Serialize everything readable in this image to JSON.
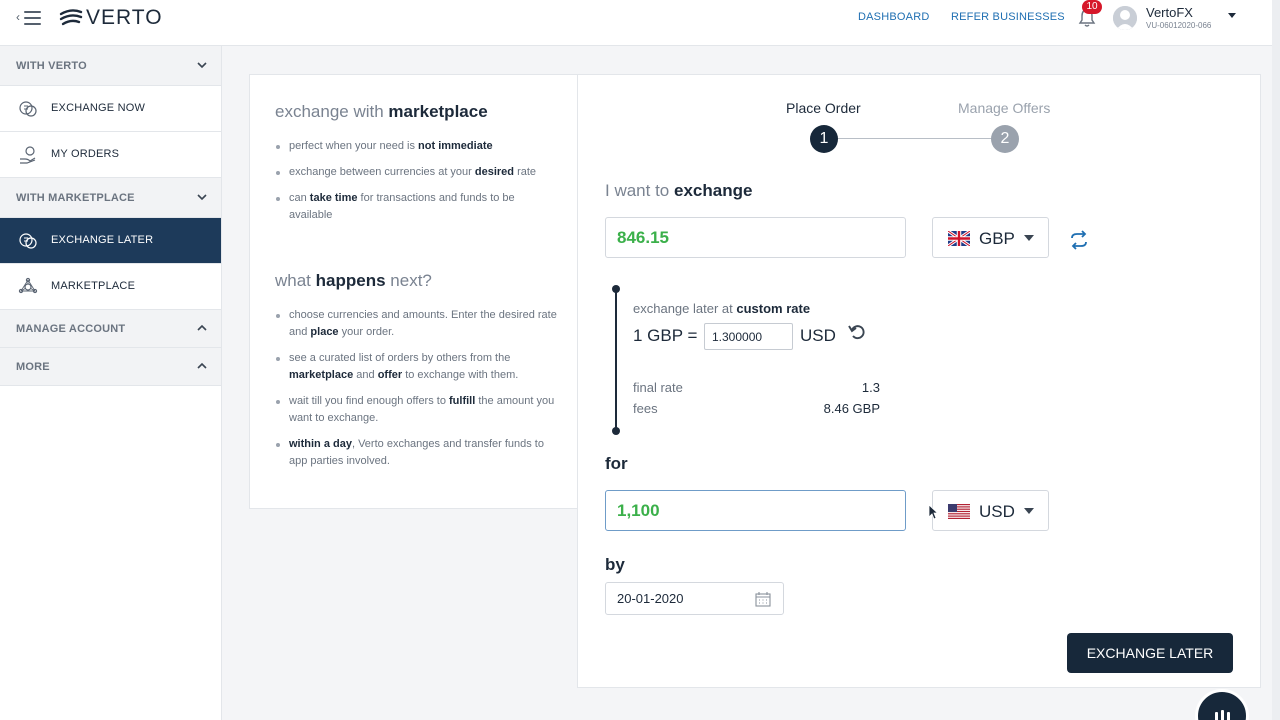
{
  "header": {
    "logo_text": "VERTO",
    "nav_dashboard": "DASHBOARD",
    "nav_refer": "REFER BUSINESSES",
    "notification_count": "10",
    "user_name": "VertoFX",
    "user_id": "VU-06012020-066"
  },
  "sidebar": {
    "section_with_verto": "WITH VERTO",
    "item_exchange_now": "EXCHANGE NOW",
    "item_my_orders": "MY ORDERS",
    "section_with_marketplace": "WITH MARKETPLACE",
    "item_exchange_later": "EXCHANGE LATER",
    "item_marketplace": "MARKETPLACE",
    "section_manage_account": "MANAGE ACCOUNT",
    "section_more": "MORE"
  },
  "info": {
    "title_prefix": "exchange with",
    "title_bold": "marketplace",
    "bullets1": [
      {
        "pre": "perfect when your need is ",
        "bold": "not immediate",
        "post": ""
      },
      {
        "pre": "exchange between currencies at your ",
        "bold": "desired",
        "post": " rate"
      },
      {
        "pre": "can ",
        "bold": "take time",
        "post": " for transactions and funds to be available"
      }
    ],
    "title2_prefix": "what",
    "title2_bold": "happens",
    "title2_suffix": "next?",
    "bullets2": [
      {
        "pre": "choose currencies and amounts. Enter the desired rate and ",
        "bold": "place",
        "post": " your order."
      },
      {
        "pre": "see a curated list of orders by others from the ",
        "bold": "marketplace",
        "post": " and ",
        "bold2": "offer",
        "post2": " to exchange with them."
      },
      {
        "pre": "wait till you find enough offers to ",
        "bold": "fulfill",
        "post": " the amount you want to exchange."
      },
      {
        "pre": "",
        "bold": "within a day",
        "post": ", Verto exchanges and transfer funds to app parties involved."
      }
    ]
  },
  "order": {
    "step1_label": "Place Order",
    "step1_num": "1",
    "step2_label": "Manage Offers",
    "step2_num": "2",
    "exchange_prefix": "I want to",
    "exchange_bold": "exchange",
    "sell_amount": "846.15",
    "sell_currency": "GBP",
    "rate_caption_prefix": "exchange later at",
    "rate_caption_bold": "custom rate",
    "rate_base": "1 GBP =",
    "rate_value": "1.300000",
    "rate_quote": "USD",
    "final_rate_label": "final rate",
    "final_rate_value": "1.3",
    "fees_label": "fees",
    "fees_value": "8.46 GBP",
    "for_label": "for",
    "buy_amount": "1,100",
    "buy_currency": "USD",
    "by_label": "by",
    "date_value": "20-01-2020",
    "cta_label": "EXCHANGE LATER"
  },
  "colors": {
    "accent_dark": "#17283a",
    "active_nav": "#1d3a5a",
    "amount_green": "#3bb04a",
    "link_blue": "#1f6fb2",
    "badge_red": "#d6182a",
    "step_inactive": "#9aa2ad"
  },
  "icons": {
    "menu": "hamburger-menu-icon",
    "bell": "bell-icon",
    "swap": "swap-arrows-icon",
    "reset": "undo-icon",
    "calendar": "calendar-icon"
  }
}
